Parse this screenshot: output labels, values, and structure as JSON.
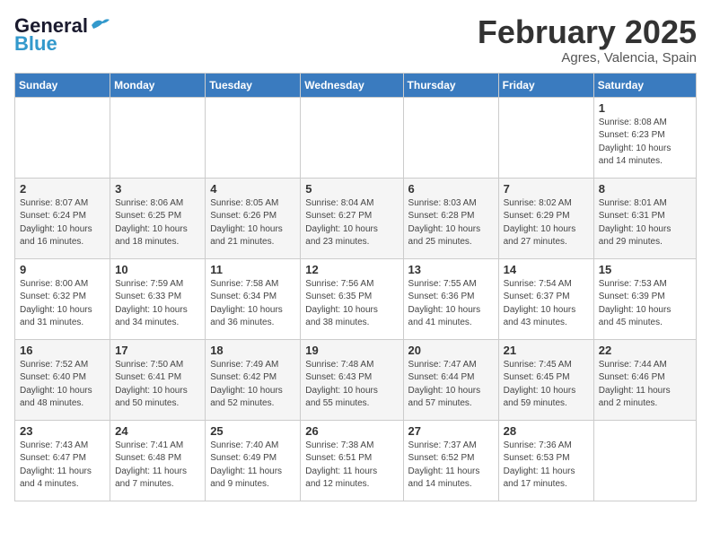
{
  "header": {
    "logo_line1": "General",
    "logo_line2": "Blue",
    "month_title": "February 2025",
    "location": "Agres, Valencia, Spain"
  },
  "days_of_week": [
    "Sunday",
    "Monday",
    "Tuesday",
    "Wednesday",
    "Thursday",
    "Friday",
    "Saturday"
  ],
  "weeks": [
    [
      {
        "day": "",
        "info": ""
      },
      {
        "day": "",
        "info": ""
      },
      {
        "day": "",
        "info": ""
      },
      {
        "day": "",
        "info": ""
      },
      {
        "day": "",
        "info": ""
      },
      {
        "day": "",
        "info": ""
      },
      {
        "day": "1",
        "info": "Sunrise: 8:08 AM\nSunset: 6:23 PM\nDaylight: 10 hours\nand 14 minutes."
      }
    ],
    [
      {
        "day": "2",
        "info": "Sunrise: 8:07 AM\nSunset: 6:24 PM\nDaylight: 10 hours\nand 16 minutes."
      },
      {
        "day": "3",
        "info": "Sunrise: 8:06 AM\nSunset: 6:25 PM\nDaylight: 10 hours\nand 18 minutes."
      },
      {
        "day": "4",
        "info": "Sunrise: 8:05 AM\nSunset: 6:26 PM\nDaylight: 10 hours\nand 21 minutes."
      },
      {
        "day": "5",
        "info": "Sunrise: 8:04 AM\nSunset: 6:27 PM\nDaylight: 10 hours\nand 23 minutes."
      },
      {
        "day": "6",
        "info": "Sunrise: 8:03 AM\nSunset: 6:28 PM\nDaylight: 10 hours\nand 25 minutes."
      },
      {
        "day": "7",
        "info": "Sunrise: 8:02 AM\nSunset: 6:29 PM\nDaylight: 10 hours\nand 27 minutes."
      },
      {
        "day": "8",
        "info": "Sunrise: 8:01 AM\nSunset: 6:31 PM\nDaylight: 10 hours\nand 29 minutes."
      }
    ],
    [
      {
        "day": "9",
        "info": "Sunrise: 8:00 AM\nSunset: 6:32 PM\nDaylight: 10 hours\nand 31 minutes."
      },
      {
        "day": "10",
        "info": "Sunrise: 7:59 AM\nSunset: 6:33 PM\nDaylight: 10 hours\nand 34 minutes."
      },
      {
        "day": "11",
        "info": "Sunrise: 7:58 AM\nSunset: 6:34 PM\nDaylight: 10 hours\nand 36 minutes."
      },
      {
        "day": "12",
        "info": "Sunrise: 7:56 AM\nSunset: 6:35 PM\nDaylight: 10 hours\nand 38 minutes."
      },
      {
        "day": "13",
        "info": "Sunrise: 7:55 AM\nSunset: 6:36 PM\nDaylight: 10 hours\nand 41 minutes."
      },
      {
        "day": "14",
        "info": "Sunrise: 7:54 AM\nSunset: 6:37 PM\nDaylight: 10 hours\nand 43 minutes."
      },
      {
        "day": "15",
        "info": "Sunrise: 7:53 AM\nSunset: 6:39 PM\nDaylight: 10 hours\nand 45 minutes."
      }
    ],
    [
      {
        "day": "16",
        "info": "Sunrise: 7:52 AM\nSunset: 6:40 PM\nDaylight: 10 hours\nand 48 minutes."
      },
      {
        "day": "17",
        "info": "Sunrise: 7:50 AM\nSunset: 6:41 PM\nDaylight: 10 hours\nand 50 minutes."
      },
      {
        "day": "18",
        "info": "Sunrise: 7:49 AM\nSunset: 6:42 PM\nDaylight: 10 hours\nand 52 minutes."
      },
      {
        "day": "19",
        "info": "Sunrise: 7:48 AM\nSunset: 6:43 PM\nDaylight: 10 hours\nand 55 minutes."
      },
      {
        "day": "20",
        "info": "Sunrise: 7:47 AM\nSunset: 6:44 PM\nDaylight: 10 hours\nand 57 minutes."
      },
      {
        "day": "21",
        "info": "Sunrise: 7:45 AM\nSunset: 6:45 PM\nDaylight: 10 hours\nand 59 minutes."
      },
      {
        "day": "22",
        "info": "Sunrise: 7:44 AM\nSunset: 6:46 PM\nDaylight: 11 hours\nand 2 minutes."
      }
    ],
    [
      {
        "day": "23",
        "info": "Sunrise: 7:43 AM\nSunset: 6:47 PM\nDaylight: 11 hours\nand 4 minutes."
      },
      {
        "day": "24",
        "info": "Sunrise: 7:41 AM\nSunset: 6:48 PM\nDaylight: 11 hours\nand 7 minutes."
      },
      {
        "day": "25",
        "info": "Sunrise: 7:40 AM\nSunset: 6:49 PM\nDaylight: 11 hours\nand 9 minutes."
      },
      {
        "day": "26",
        "info": "Sunrise: 7:38 AM\nSunset: 6:51 PM\nDaylight: 11 hours\nand 12 minutes."
      },
      {
        "day": "27",
        "info": "Sunrise: 7:37 AM\nSunset: 6:52 PM\nDaylight: 11 hours\nand 14 minutes."
      },
      {
        "day": "28",
        "info": "Sunrise: 7:36 AM\nSunset: 6:53 PM\nDaylight: 11 hours\nand 17 minutes."
      },
      {
        "day": "",
        "info": ""
      }
    ]
  ]
}
